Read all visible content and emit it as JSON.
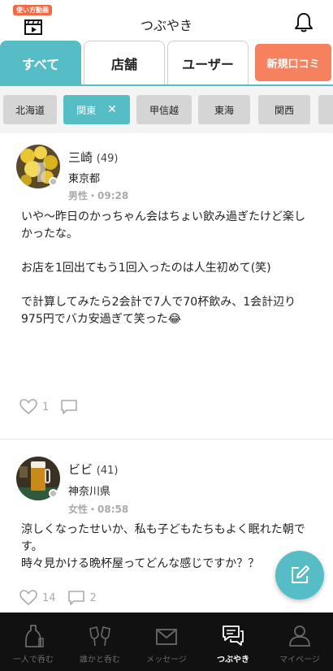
{
  "header": {
    "how_to_badge": "使い方動画",
    "title": "つぶやき"
  },
  "tabs": {
    "all": "すべて",
    "shop": "店舗",
    "user": "ユーザー",
    "new_review": "新規口コミ"
  },
  "regions": [
    {
      "label": "北海道",
      "active": false
    },
    {
      "label": "関東",
      "active": true,
      "remove": "✕"
    },
    {
      "label": "甲信越",
      "active": false
    },
    {
      "label": "東海",
      "active": false
    },
    {
      "label": "関西",
      "active": false
    }
  ],
  "posts": [
    {
      "name": "三崎",
      "age": "(49)",
      "prefecture": "東京都",
      "meta": "男性・09:28",
      "body": "いや〜昨日のかっちゃん会はちょい飲み過ぎたけど楽しかったな。\n\nお店を1回出てもう1回入ったのは人生初めて(笑)\n\nで計算してみたら2会計で7人で70杯飲み、1会計辺り975円でバカ安過ぎて笑った😂",
      "likes": "1",
      "comments": ""
    },
    {
      "name": "ビビ",
      "age": "(41)",
      "prefecture": "神奈川県",
      "meta": "女性・08:58",
      "body": "涼しくなったせいか、私も子どもたちもよく眠れた朝です。\n時々見かける晩杯屋ってどんな感じですか？？",
      "likes": "14",
      "comments": "2"
    }
  ],
  "bottom_nav": [
    {
      "label": "一人で呑む",
      "icon": "sake-icon",
      "active": false
    },
    {
      "label": "誰かと呑む",
      "icon": "cheers-icon",
      "active": false
    },
    {
      "label": "メッセージ",
      "icon": "envelope-icon",
      "active": false
    },
    {
      "label": "つぶやき",
      "icon": "chat-bubbles-icon",
      "active": true
    },
    {
      "label": "マイページ",
      "icon": "user-icon",
      "active": false
    }
  ],
  "colors": {
    "accent": "#56bcc6",
    "cta": "#f5815f",
    "badge": "#ef6a45",
    "nav_bg": "#111111"
  }
}
